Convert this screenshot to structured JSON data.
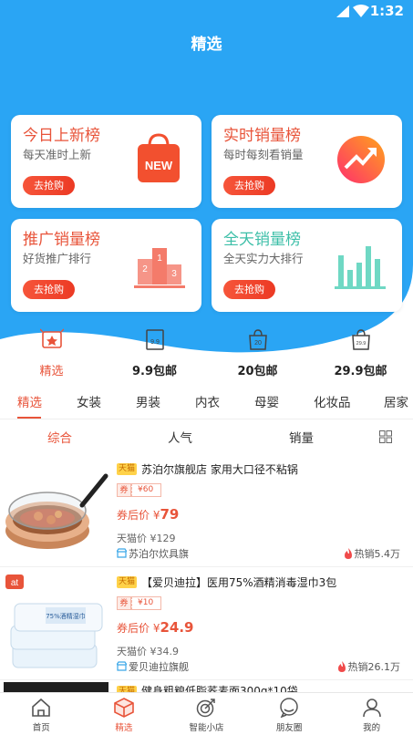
{
  "status_bar": {
    "time": "1:32"
  },
  "header": {
    "title": "精选"
  },
  "cards": [
    {
      "title": "今日上新榜",
      "subtitle": "每天准时上新",
      "button": "去抢购",
      "title_color": "#e8543a",
      "icon": "new-bag-icon"
    },
    {
      "title": "实时销量榜",
      "subtitle": "每时每刻看销量",
      "button": "去抢购",
      "title_color": "#e8543a",
      "icon": "trend-up-icon"
    },
    {
      "title": "推广销量榜",
      "subtitle": "好货推广排行",
      "button": "去抢购",
      "title_color": "#e8543a",
      "icon": "podium-icon"
    },
    {
      "title": "全天销量榜",
      "subtitle": "全天实力大排行",
      "button": "去抢购",
      "title_color": "#3dbfa8",
      "icon": "bar-chart-icon"
    }
  ],
  "categories": [
    {
      "label": "精选",
      "icon": "featured-icon",
      "active": true
    },
    {
      "label": "9.9包邮",
      "icon": "calendar-99-icon"
    },
    {
      "label": "20包邮",
      "icon": "bag-20-icon"
    },
    {
      "label": "29.9包邮",
      "icon": "bag-299-icon"
    }
  ],
  "category_icon_text": {
    "c1": "9.9",
    "c2": "20",
    "c3": "29.9"
  },
  "tabs": [
    "精选",
    "女装",
    "男装",
    "内衣",
    "母婴",
    "化妆品",
    "居家"
  ],
  "sort": {
    "comprehensive": "综合",
    "popularity": "人气",
    "sales": "销量"
  },
  "products": [
    {
      "tag": "天猫",
      "title": "苏泊尔旗舰店 家用大口径不粘锅",
      "coupon_label": "券",
      "coupon_value": "¥60",
      "after_label": "券后价",
      "after_price_currency": "¥",
      "after_price": "79",
      "tmall_price": "天猫价 ¥129",
      "shop": "苏泊尔炊具旗",
      "hot": "热销5.4万"
    },
    {
      "tag": "天猫",
      "title": "【爱贝迪拉】医用75%酒精消毒湿巾3包",
      "coupon_label": "券",
      "coupon_value": "¥10",
      "after_label": "券后价",
      "after_price_currency": "¥",
      "after_price": "24.9",
      "tmall_price": "天猫价 ¥34.9",
      "shop": "爱贝迪拉旗舰",
      "hot": "热销26.1万",
      "brand_badge": "at",
      "pack_text": "75%酒精湿巾"
    },
    {
      "tag": "天猫",
      "title": "健身粗粮低脂荞麦面300g*10袋"
    }
  ],
  "bottom_nav": [
    {
      "label": "首页",
      "icon": "home-icon"
    },
    {
      "label": "精选",
      "icon": "box-icon",
      "active": true
    },
    {
      "label": "智能小店",
      "icon": "target-icon"
    },
    {
      "label": "朋友圈",
      "icon": "chat-bubble-icon"
    },
    {
      "label": "我的",
      "icon": "user-icon"
    }
  ],
  "colors": {
    "brand_blue": "#2aa5f4",
    "accent": "#e8543a",
    "teal": "#3dbfa8"
  }
}
